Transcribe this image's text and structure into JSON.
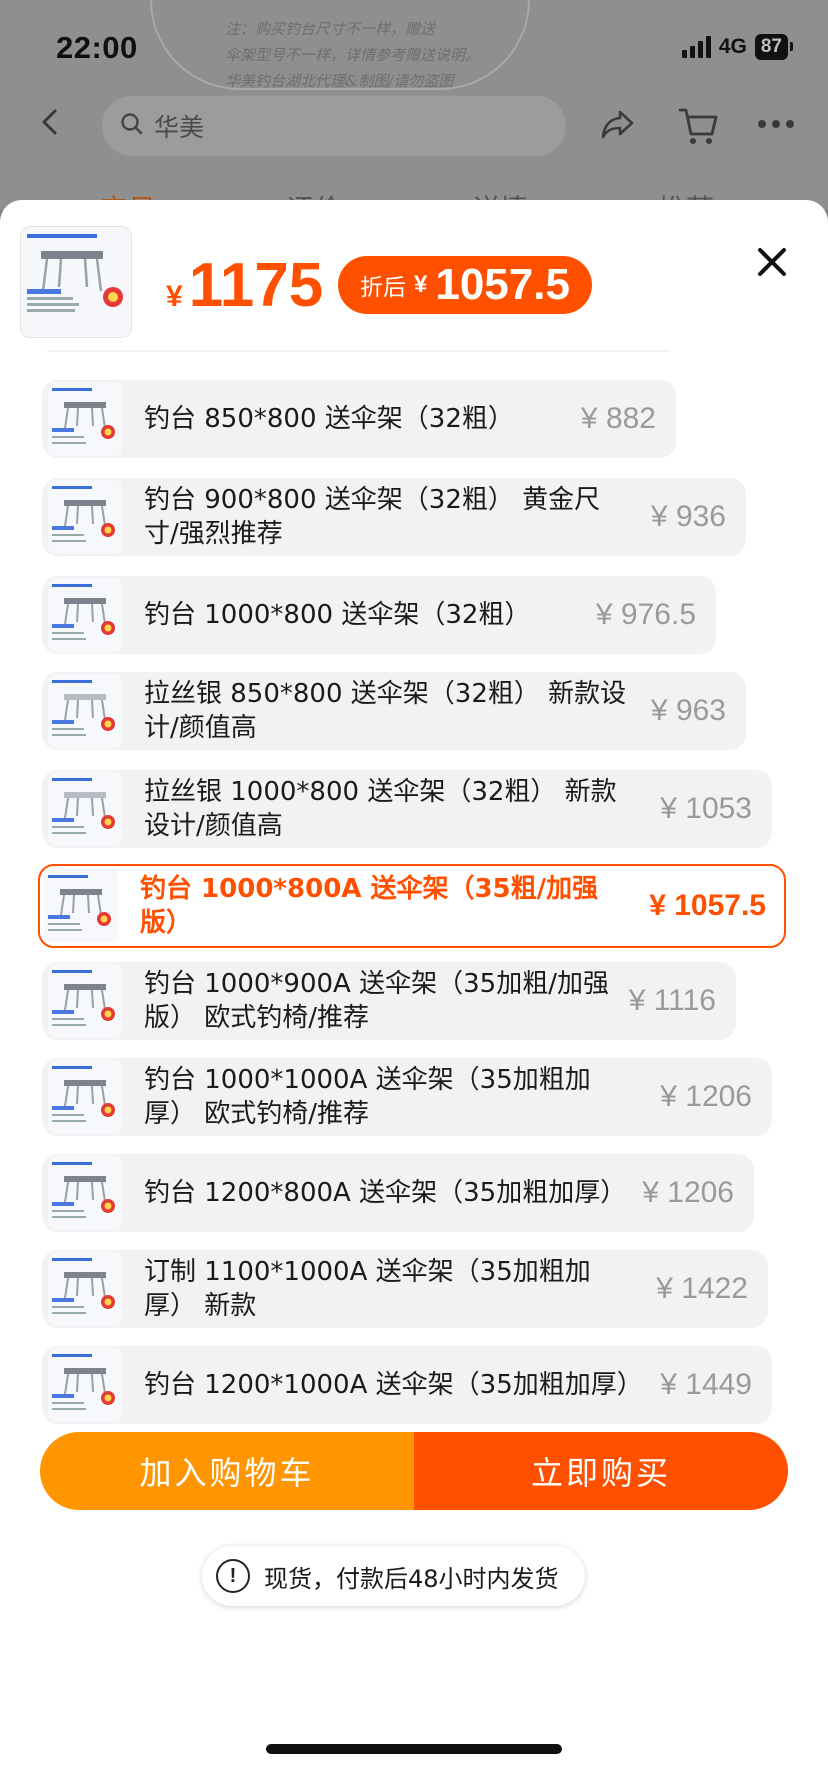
{
  "status_bar": {
    "time": "22:00",
    "network": "4G",
    "battery": "87"
  },
  "background_page": {
    "note_lines": [
      "注：购买钓台尺寸不一样，赠送",
      "伞架型号不一样，详情参考赠送说明。",
      "华美钓台湖北代理&制图/请勿盗图"
    ],
    "search": {
      "text": "华美"
    },
    "tabs": [
      "宝贝",
      "评价",
      "详情",
      "推荐"
    ]
  },
  "sheet": {
    "price": {
      "currency": "¥",
      "value": "1175"
    },
    "discount": {
      "label": "折后",
      "currency": "¥",
      "value": "1057.5"
    },
    "options": [
      {
        "name": "钓台 850*800 送伞架（32粗）",
        "price": "¥ 882",
        "selected": false
      },
      {
        "name": "钓台 900*800 送伞架（32粗） 黄金尺寸/强烈推荐",
        "price": "¥ 936",
        "selected": false
      },
      {
        "name": "钓台 1000*800 送伞架（32粗）",
        "price": "¥ 976.5",
        "selected": false
      },
      {
        "name": "拉丝银 850*800 送伞架（32粗） 新款设计/颜值高",
        "price": "¥ 963",
        "selected": false
      },
      {
        "name": "拉丝银 1000*800 送伞架（32粗） 新款设计/颜值高",
        "price": "¥ 1053",
        "selected": false
      },
      {
        "name": "钓台 1000*800A 送伞架（35粗/加强版）",
        "price": "¥ 1057.5",
        "selected": true
      },
      {
        "name": "钓台 1000*900A 送伞架（35加粗/加强版） 欧式钓椅/推荐",
        "price": "¥ 1116",
        "selected": false
      },
      {
        "name": "钓台 1000*1000A 送伞架（35加粗加厚） 欧式钓椅/推荐",
        "price": "¥ 1206",
        "selected": false
      },
      {
        "name": "钓台 1200*800A 送伞架（35加粗加厚）",
        "price": "¥ 1206",
        "selected": false
      },
      {
        "name": "订制 1100*1000A 送伞架（35加粗加厚） 新款",
        "price": "¥ 1422",
        "selected": false
      },
      {
        "name": "钓台 1200*1000A 送伞架（35加粗加厚）",
        "price": "¥ 1449",
        "selected": false
      }
    ],
    "toast": {
      "icon": "!",
      "text": "现货，付款后48小时内发货"
    },
    "actions": {
      "add_to_cart": "加入购物车",
      "buy_now": "立即购买"
    }
  },
  "colors": {
    "accent": "#ff5000",
    "cart": "#ff9500",
    "option_bg": "#f2f2f2",
    "muted_price": "#9a9a9a"
  }
}
